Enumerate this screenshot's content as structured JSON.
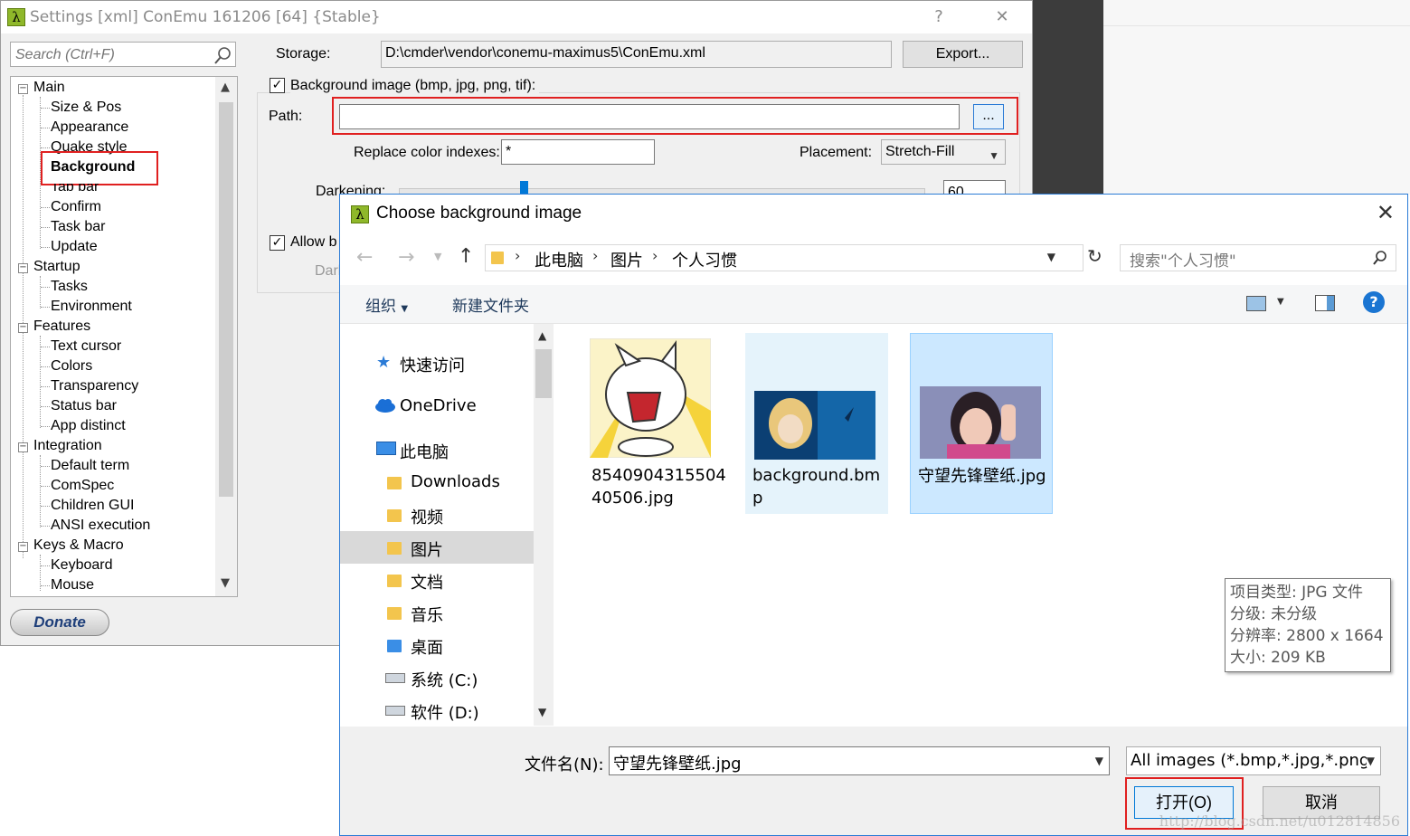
{
  "settings_window": {
    "title": "Settings [xml] ConEmu 161206 [64] {Stable}",
    "help_glyph": "?",
    "close_glyph": "✕",
    "search_placeholder": "Search (Ctrl+F)",
    "tree": {
      "main": "Main",
      "size_pos": "Size & Pos",
      "appearance": "Appearance",
      "quake_style": "Quake style",
      "background": "Background",
      "tab_bar": "Tab bar",
      "confirm": "Confirm",
      "task_bar": "Task bar",
      "update": "Update",
      "startup": "Startup",
      "tasks": "Tasks",
      "environment": "Environment",
      "features": "Features",
      "text_cursor": "Text cursor",
      "colors": "Colors",
      "transparency": "Transparency",
      "status_bar": "Status bar",
      "app_distinct": "App distinct",
      "integration": "Integration",
      "default_term": "Default term",
      "comspec": "ComSpec",
      "children_gui": "Children GUI",
      "ansi_execution": "ANSI execution",
      "keys_macro": "Keys & Macro",
      "keyboard": "Keyboard",
      "mouse": "Mouse"
    },
    "donate_label": "Donate",
    "storage_label": "Storage:",
    "storage_value": "D:\\cmder\\vendor\\conemu-maximus5\\ConEmu.xml",
    "export_label": "Export...",
    "bg_image_label": "Background image (bmp, jpg, png, tif):",
    "path_label": "Path:",
    "path_value": "",
    "browse_label": "...",
    "replace_color_label": "Replace color indexes:",
    "replace_color_value": "*",
    "placement_label": "Placement:",
    "placement_value": "Stretch-Fill",
    "darkening_label": "Darkening:",
    "darkening_value": "60",
    "allow_label": "Allow b",
    "dark_label": "Dark"
  },
  "dialog": {
    "title": "Choose background image",
    "breadcrumb": [
      "此电脑",
      "图片",
      "个人习惯"
    ],
    "search_placeholder": "搜索\"个人习惯\"",
    "toolbar": {
      "organize": "组织",
      "new_folder": "新建文件夹"
    },
    "nav": {
      "quick_access": "快速访问",
      "onedrive": "OneDrive",
      "this_pc": "此电脑",
      "downloads": "Downloads",
      "videos": "视频",
      "pictures": "图片",
      "documents": "文档",
      "music": "音乐",
      "desktop": "桌面",
      "drive_c": "系统 (C:)",
      "drive_d": "软件 (D:)"
    },
    "files": [
      {
        "name": "854090431550440506.jpg"
      },
      {
        "name": "background.bmp"
      },
      {
        "name": "守望先锋壁纸.jpg"
      }
    ],
    "tooltip": {
      "type": "项目类型: JPG 文件",
      "rating": "分级: 未分级",
      "resolution": "分辨率: 2800 x 1664",
      "size": "大小: 209 KB"
    },
    "filename_label": "文件名(N):",
    "filename_value": "守望先锋壁纸.jpg",
    "filter_value": "All images (*.bmp,*.jpg,*.png",
    "open_label": "打开(O)",
    "cancel_label": "取消",
    "watermark": "http://blog.csdn.net/u012814856"
  },
  "colors": {
    "accent_blue": "#2b7bd6",
    "highlight_red": "#e02020",
    "selection": "#cce8ff"
  }
}
